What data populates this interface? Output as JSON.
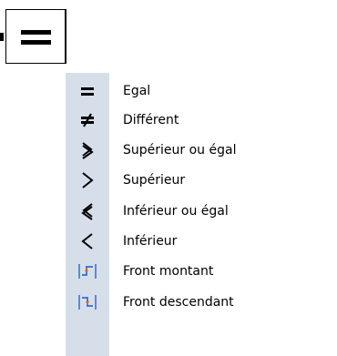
{
  "toolbar": {
    "compare_button_icon": "equals-icon"
  },
  "menu": {
    "items": [
      {
        "label": "Egal",
        "icon": "equals-icon"
      },
      {
        "label": "Différent",
        "icon": "not-equal-icon"
      },
      {
        "label": "Supérieur ou égal",
        "icon": "greater-or-equal-icon"
      },
      {
        "label": "Supérieur",
        "icon": "greater-than-icon"
      },
      {
        "label": "Inférieur ou égal",
        "icon": "less-or-equal-icon"
      },
      {
        "label": "Inférieur",
        "icon": "less-than-icon"
      },
      {
        "label": "Front montant",
        "icon": "rising-edge-icon"
      },
      {
        "label": "Front descendant",
        "icon": "falling-edge-icon"
      }
    ]
  },
  "colors": {
    "gutter": "#d6dfe9",
    "icon_dark": "#000000",
    "edge_icon_blue": "#2f6fd6"
  }
}
